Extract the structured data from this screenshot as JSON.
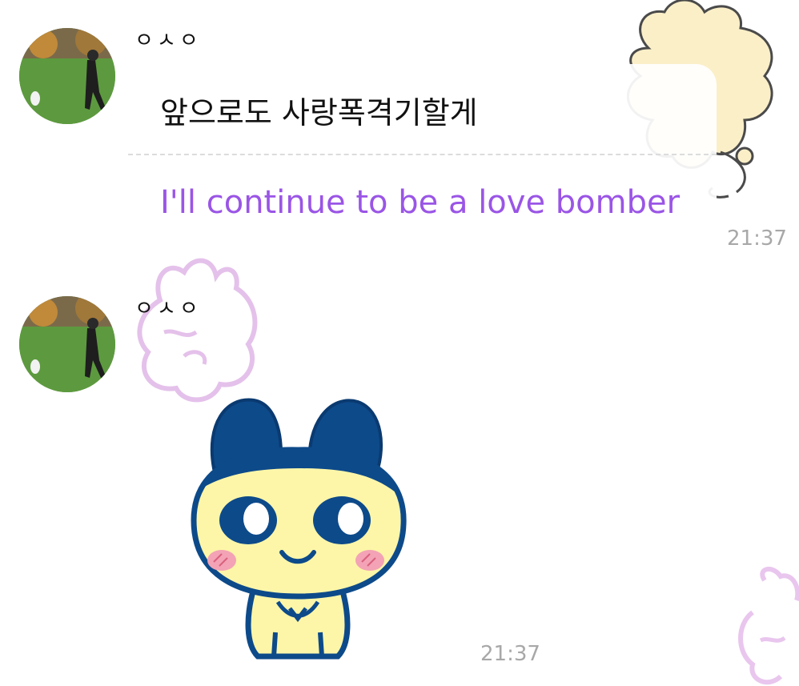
{
  "messages": [
    {
      "sender": "ㅇㅅㅇ",
      "avatar": "profile-photo-park",
      "text": "앞으로도 사랑폭격기할게",
      "translation": "I'll continue to be a love bomber",
      "time": "21:37"
    },
    {
      "sender": "ㅇㅅㅇ",
      "avatar": "profile-photo-park",
      "sticker": "mametchi-sticker",
      "time": "21:37"
    }
  ],
  "colors": {
    "translation": "#9a55e6",
    "time": "#a8a8a8",
    "sticker_navy": "#0d4a8a",
    "sticker_yellow": "#fdf6a8",
    "sticker_cheek": "#f3a3b5",
    "bg_doodle_yellow": "#fbefc8",
    "bg_doodle_pink": "#e9c6ee"
  }
}
